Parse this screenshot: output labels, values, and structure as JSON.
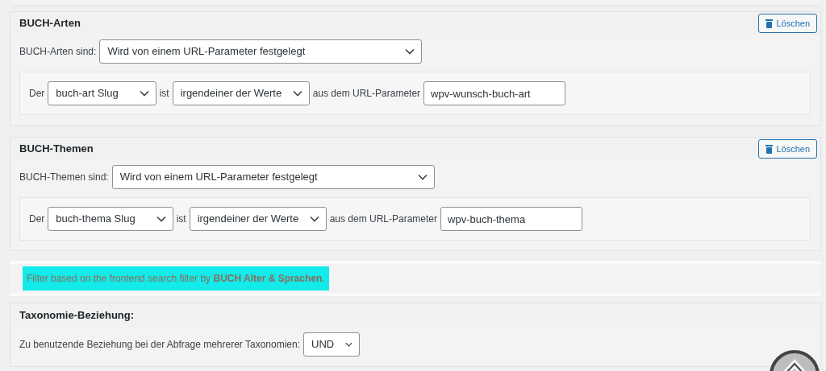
{
  "filters": [
    {
      "title": "BUCH-Arten",
      "delete_button": "Löschen",
      "mode_label": "BUCH-Arten sind:",
      "mode_value": "Wird von einem URL-Parameter festgelegt",
      "condition": {
        "prefix": "Der",
        "field": "buch-art Slug",
        "verb": "ist",
        "operator": "irgendeiner der Werte",
        "source_label": "aus dem URL-Parameter",
        "parameter": "wpv-wunsch-buch-art"
      }
    },
    {
      "title": "BUCH-Themen",
      "delete_button": "Löschen",
      "mode_label": "BUCH-Themen sind:",
      "mode_value": "Wird von einem URL-Parameter festgelegt",
      "condition": {
        "prefix": "Der",
        "field": "buch-thema Slug",
        "verb": "ist",
        "operator": "irgendeiner der Werte",
        "source_label": "aus dem URL-Parameter",
        "parameter": "wpv-buch-thema"
      }
    }
  ],
  "note": "Filter based on the frontend search filter by **BUCH Alter & Sprachen**.",
  "relationship": {
    "title": "Taxonomie-Beziehung:",
    "label": "Zu benutzende Beziehung bei der Abfrage mehrerer Taxonomien:",
    "value": "UND"
  }
}
